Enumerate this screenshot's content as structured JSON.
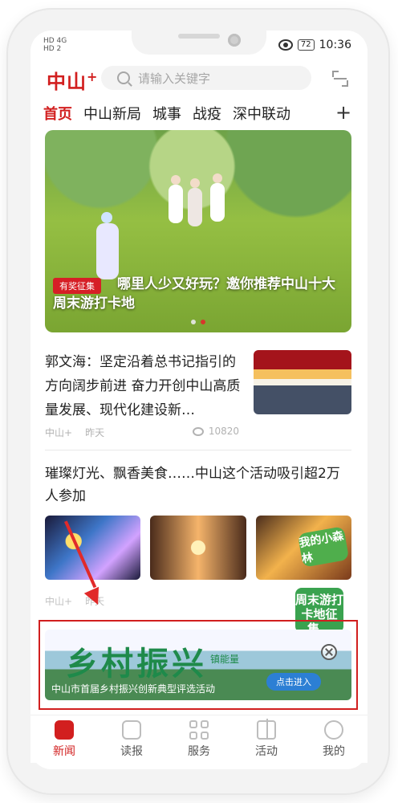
{
  "status": {
    "hd_top": "HD 4G",
    "hd_bottom": "HD 2",
    "battery": "72",
    "time": "10:36"
  },
  "app": {
    "logo_text": "中山",
    "logo_plus": "+",
    "search_placeholder": "请输入关键字"
  },
  "tabs": [
    {
      "label": "首页",
      "active": true
    },
    {
      "label": "中山新局",
      "active": false
    },
    {
      "label": "城事",
      "active": false
    },
    {
      "label": "战疫",
      "active": false
    },
    {
      "label": "深中联动",
      "active": false
    }
  ],
  "hero": {
    "badge": "有奖征集",
    "title": "哪里人少又好玩？邀你推荐中山十大周末游打卡地",
    "slides": 2,
    "current_slide": 2
  },
  "article1": {
    "title": "郭文海：坚定沿着总书记指引的方向阔步前进 奋力开创中山高质量发展、现代化建设新…",
    "source": "中山+",
    "time": "昨天",
    "views": "10820"
  },
  "article2": {
    "title": "璀璨灯光、飘香美食……中山这个活动吸引超2万人参加",
    "source": "中山+",
    "time": "昨天",
    "image3_text": "我的小森林"
  },
  "weekend_badge": "周末游打卡地征集。",
  "ad": {
    "title": "乡村振兴",
    "subtitle": "镇能量",
    "caption": "中山市首届乡村振兴创新典型评选活动",
    "cta": "点击进入"
  },
  "bottom_nav": [
    {
      "label": "新闻",
      "active": true
    },
    {
      "label": "读报",
      "active": false
    },
    {
      "label": "服务",
      "active": false
    },
    {
      "label": "活动",
      "active": false
    },
    {
      "label": "我的",
      "active": false
    }
  ]
}
